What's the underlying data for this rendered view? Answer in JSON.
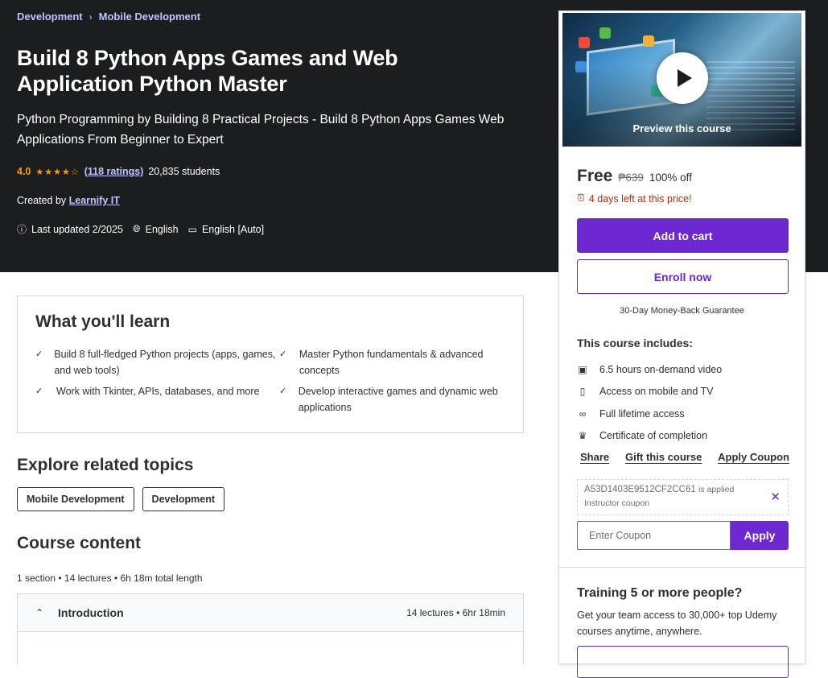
{
  "breadcrumb": [
    "Development",
    "Mobile Development"
  ],
  "course": {
    "title": "Build 8 Python Apps Games and Web Application Python Master",
    "subtitle": "Python Programming by Building 8 Practical Projects - Build 8 Python Apps Games Web Applications From Beginner to Expert",
    "rating": "4.0",
    "stars_filled": 4,
    "ratings_count": "(118 ratings)",
    "students": "20,835 students",
    "created_by_label": "Created by",
    "instructor": "Learnify IT",
    "last_updated": "Last updated 2/2025",
    "language": "English",
    "captions": "English [Auto]"
  },
  "sidebar": {
    "preview_label": "Preview this course",
    "price": "Free",
    "old_price": "₱639",
    "discount": "100% off",
    "timer": "4 days left at this price!",
    "add_to_cart": "Add to cart",
    "enroll_now": "Enroll now",
    "guarantee": "30-Day Money-Back Guarantee",
    "includes_title": "This course includes:",
    "includes": [
      {
        "icon": "video-icon",
        "text": "6.5 hours on-demand video"
      },
      {
        "icon": "mobile-icon",
        "text": "Access on mobile and TV"
      },
      {
        "icon": "infinity-icon",
        "text": "Full lifetime access"
      },
      {
        "icon": "trophy-icon",
        "text": "Certificate of completion"
      }
    ],
    "share": "Share",
    "gift": "Gift this course",
    "apply_coupon": "Apply Coupon",
    "coupon_code": "A53D1403E9512CF2CC61",
    "coupon_applied": "is applied",
    "coupon_type": "Instructor coupon",
    "coupon_placeholder": "Enter Coupon",
    "apply": "Apply",
    "training_title": "Training 5 or more people?",
    "training_text": "Get your team access to 30,000+ top Udemy courses anytime, anywhere."
  },
  "learn": {
    "title": "What you'll learn",
    "items": [
      "Build 8 full-fledged Python projects (apps, games, and web tools)",
      "Master Python fundamentals & advanced concepts",
      "Work with Tkinter, APIs, databases, and more",
      "Develop interactive games and dynamic web applications"
    ]
  },
  "related": {
    "title": "Explore related topics",
    "topics": [
      "Mobile Development",
      "Development"
    ]
  },
  "content": {
    "title": "Course content",
    "meta": "1 section • 14 lectures • 6h 18m total length",
    "sections": [
      {
        "name": "Introduction",
        "stats": "14 lectures • 6hr 18min"
      }
    ]
  },
  "colors": {
    "accent": "#6d28d2",
    "hero_bg": "#1c1d1f",
    "rating": "#f69c08",
    "timer": "#b32d0f",
    "link": "#c0c4fc"
  }
}
